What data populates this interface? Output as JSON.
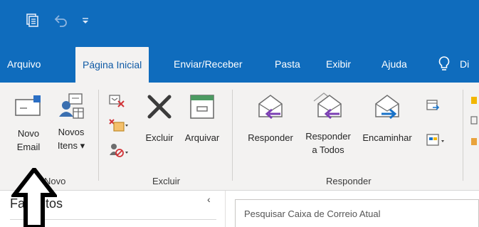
{
  "quick_access": {
    "icons": [
      "send-receive-all-folders-icon",
      "undo-icon",
      "customize-quick-access-icon"
    ]
  },
  "tabs": [
    {
      "label": "Arquivo",
      "active": false
    },
    {
      "label": "Página Inicial",
      "active": true
    },
    {
      "label": "Enviar/Receber",
      "active": false
    },
    {
      "label": "Pasta",
      "active": false
    },
    {
      "label": "Exibir",
      "active": false
    },
    {
      "label": "Ajuda",
      "active": false
    },
    {
      "label": "Di",
      "active": false
    }
  ],
  "ribbon": {
    "novo_group": {
      "label": "Novo",
      "new_email": {
        "line1": "Novo",
        "line2": "Email"
      },
      "new_items": {
        "line1": "Novos",
        "line2": "Itens ▾"
      }
    },
    "excluir_group": {
      "label": "Excluir",
      "delete_label": "Excluir",
      "archive_label": "Arquivar"
    },
    "responder_group": {
      "label": "Responder",
      "reply_label": "Responder",
      "reply_all": {
        "line1": "Responder",
        "line2": "a Todos"
      },
      "forward_label": "Encaminhar"
    }
  },
  "folder_pane": {
    "favorites_label": "Favoritos",
    "collapse_glyph": "‹"
  },
  "search": {
    "placeholder": "Pesquisar Caixa de Correio Atual"
  },
  "colors": {
    "accent": "#0f6cbd",
    "ribbon_bg": "#f3f2f1",
    "reply_arrow": "#7b3fb3",
    "forward_arrow": "#1a73c8",
    "delete_x": "#3b3b3b"
  }
}
